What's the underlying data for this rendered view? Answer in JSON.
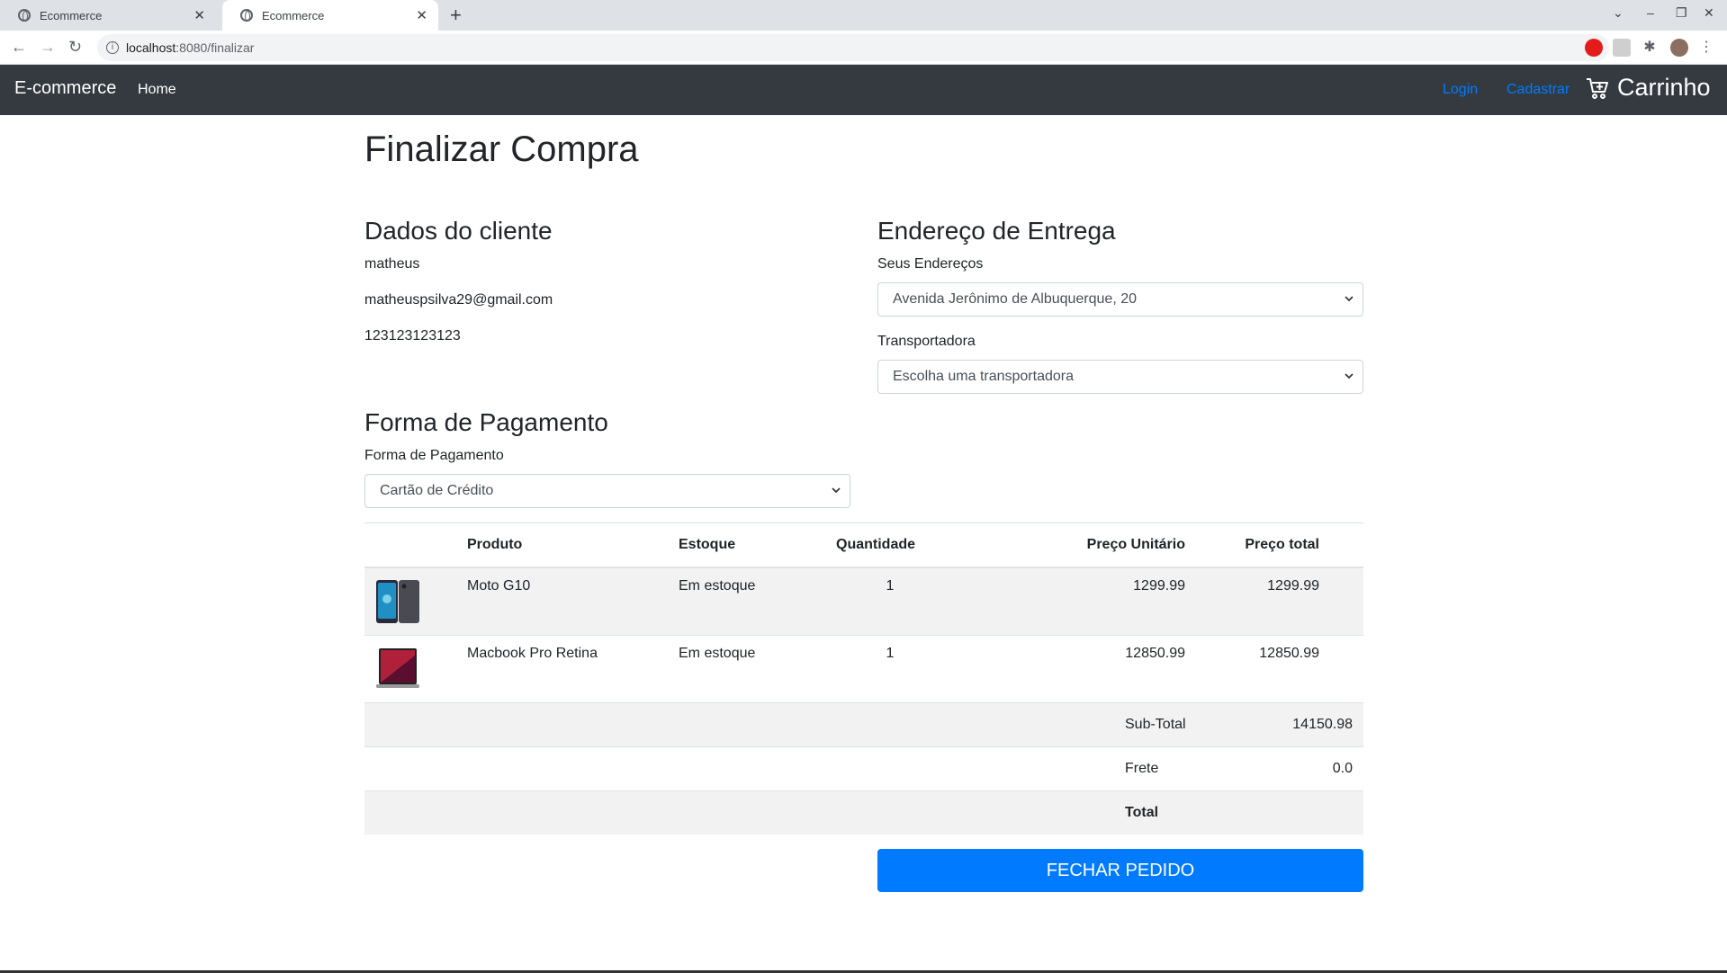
{
  "browser": {
    "tabs": [
      {
        "title": "Ecommerce"
      },
      {
        "title": "Ecommerce"
      }
    ],
    "url_host": "localhost",
    "url_path": ":8080/finalizar"
  },
  "navbar": {
    "brand": "E-commerce",
    "home": "Home",
    "login": "Login",
    "cadastrar": "Cadastrar",
    "cart": "Carrinho"
  },
  "page": {
    "title": "Finalizar Compra"
  },
  "cliente": {
    "heading": "Dados do cliente",
    "nome": "matheus",
    "email": "matheuspsilva29@gmail.com",
    "telefone": "123123123123"
  },
  "entrega": {
    "heading": "Endereço de Entrega",
    "enderecos_label": "Seus Endereços",
    "endereco_selected": "Avenida Jerônimo de Albuquerque, 20",
    "transportadora_label": "Transportadora",
    "transportadora_selected": "Escolha uma transportadora"
  },
  "pagamento": {
    "heading": "Forma de Pagamento",
    "label": "Forma de Pagamento",
    "selected": "Cartão de Crédito"
  },
  "table": {
    "headers": {
      "produto": "Produto",
      "estoque": "Estoque",
      "quantidade": "Quantidade",
      "preco_unitario": "Preço Unitário",
      "preco_total": "Preço total"
    },
    "rows": [
      {
        "produto": "Moto G10",
        "estoque": "Em estoque",
        "quantidade": "1",
        "preco_unitario": "1299.99",
        "preco_total": "1299.99"
      },
      {
        "produto": "Macbook Pro Retina",
        "estoque": "Em estoque",
        "quantidade": "1",
        "preco_unitario": "12850.99",
        "preco_total": "12850.99"
      }
    ],
    "subtotal_label": "Sub-Total",
    "subtotal_value": "14150.98",
    "frete_label": "Frete",
    "frete_value": "0.0",
    "total_label": "Total"
  },
  "actions": {
    "fechar": "FECHAR PEDIDO"
  },
  "colors": {
    "navbar": "#343a40",
    "primary": "#007bff"
  }
}
